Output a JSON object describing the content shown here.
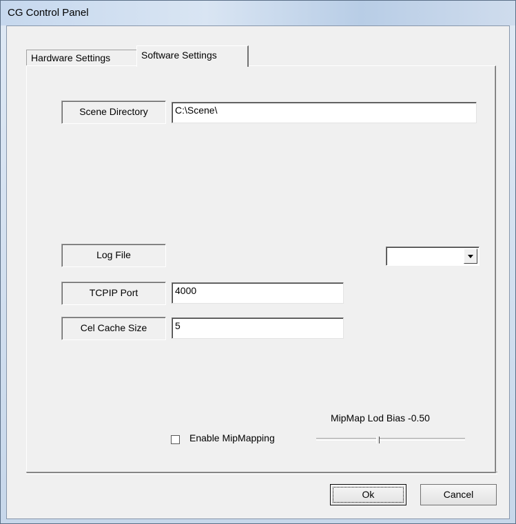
{
  "window": {
    "title": "CG Control Panel"
  },
  "tabs": [
    {
      "label": "Hardware Settings",
      "active": false
    },
    {
      "label": "Software Settings",
      "active": true
    }
  ],
  "fields": {
    "scene_directory": {
      "label": "Scene Directory",
      "value": "C:\\Scene\\"
    },
    "log_file": {
      "label": "Log File",
      "value": ""
    },
    "tcpip_port": {
      "label": "TCPIP Port",
      "value": "4000"
    },
    "cel_cache_size": {
      "label": "Cel Cache Size",
      "value": "5"
    }
  },
  "mipmapping": {
    "checkbox_label": "Enable MipMapping",
    "checked": false,
    "bias_label": "MipMap Lod Bias -0.50",
    "bias_value": -0.5
  },
  "buttons": {
    "ok": "Ok",
    "cancel": "Cancel"
  }
}
